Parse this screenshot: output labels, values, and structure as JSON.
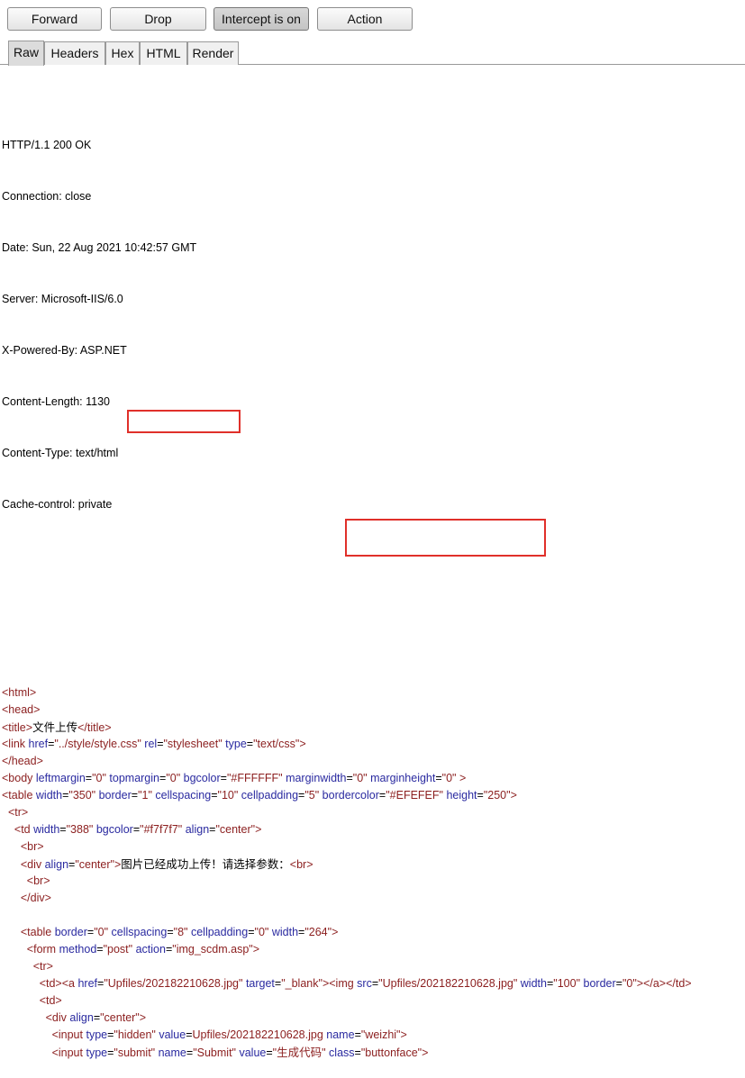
{
  "toolbar": {
    "forward": "Forward",
    "drop": "Drop",
    "intercept": "Intercept is on",
    "action": "Action"
  },
  "tabs": [
    "Raw",
    "Headers",
    "Hex",
    "HTML",
    "Render"
  ],
  "headers": [
    "HTTP/1.1 200 OK",
    "Connection: close",
    "Date: Sun, 22 Aug 2021 10:42:57 GMT",
    "Server: Microsoft-IIS/6.0",
    "X-Powered-By: ASP.NET",
    "Content-Length: 1130",
    "Content-Type: text/html",
    "Cache-control: private"
  ],
  "body_lines": [
    {
      "indent": "",
      "tokens": [
        [
          "t",
          "<html>"
        ]
      ]
    },
    {
      "indent": "",
      "tokens": [
        [
          "t",
          "<head>"
        ]
      ]
    },
    {
      "indent": "",
      "tokens": [
        [
          "t",
          "<title>"
        ],
        [
          "cn",
          "文件上传"
        ],
        [
          "t",
          "</title>"
        ]
      ]
    },
    {
      "indent": "",
      "tokens": [
        [
          "t",
          "<link "
        ],
        [
          "a",
          "href"
        ],
        [
          "p",
          "="
        ],
        [
          "v",
          "\"../style/style.css\""
        ],
        [
          "p",
          " "
        ],
        [
          "a",
          "rel"
        ],
        [
          "p",
          "="
        ],
        [
          "v",
          "\"stylesheet\""
        ],
        [
          "p",
          " "
        ],
        [
          "a",
          "type"
        ],
        [
          "p",
          "="
        ],
        [
          "v",
          "\"text/css\""
        ],
        [
          "t",
          ">"
        ]
      ]
    },
    {
      "indent": "",
      "tokens": [
        [
          "t",
          "</head>"
        ]
      ]
    },
    {
      "indent": "",
      "tokens": [
        [
          "t",
          "<body "
        ],
        [
          "a",
          "leftmargin"
        ],
        [
          "p",
          "="
        ],
        [
          "v",
          "\"0\""
        ],
        [
          "p",
          " "
        ],
        [
          "a",
          "topmargin"
        ],
        [
          "p",
          "="
        ],
        [
          "v",
          "\"0\""
        ],
        [
          "p",
          " "
        ],
        [
          "a",
          "bgcolor"
        ],
        [
          "p",
          "="
        ],
        [
          "v",
          "\"#FFFFFF\""
        ],
        [
          "p",
          " "
        ],
        [
          "a",
          "marginwidth"
        ],
        [
          "p",
          "="
        ],
        [
          "v",
          "\"0\""
        ],
        [
          "p",
          " "
        ],
        [
          "a",
          "marginheight"
        ],
        [
          "p",
          "="
        ],
        [
          "v",
          "\"0\""
        ],
        [
          "t",
          " >"
        ]
      ]
    },
    {
      "indent": "",
      "tokens": [
        [
          "t",
          "<table "
        ],
        [
          "a",
          "width"
        ],
        [
          "p",
          "="
        ],
        [
          "v",
          "\"350\""
        ],
        [
          "p",
          " "
        ],
        [
          "a",
          "border"
        ],
        [
          "p",
          "="
        ],
        [
          "v",
          "\"1\""
        ],
        [
          "p",
          " "
        ],
        [
          "a",
          "cellspacing"
        ],
        [
          "p",
          "="
        ],
        [
          "v",
          "\"10\""
        ],
        [
          "p",
          " "
        ],
        [
          "a",
          "cellpadding"
        ],
        [
          "p",
          "="
        ],
        [
          "v",
          "\"5\""
        ],
        [
          "p",
          " "
        ],
        [
          "a",
          "bordercolor"
        ],
        [
          "p",
          "="
        ],
        [
          "v",
          "\"#EFEFEF\""
        ],
        [
          "p",
          " "
        ],
        [
          "a",
          "height"
        ],
        [
          "p",
          "="
        ],
        [
          "v",
          "\"250\""
        ],
        [
          "t",
          ">"
        ]
      ]
    },
    {
      "indent": "  ",
      "tokens": [
        [
          "t",
          "<tr>"
        ]
      ]
    },
    {
      "indent": "    ",
      "tokens": [
        [
          "t",
          "<td "
        ],
        [
          "a",
          "width"
        ],
        [
          "p",
          "="
        ],
        [
          "v",
          "\"388\""
        ],
        [
          "p",
          " "
        ],
        [
          "a",
          "bgcolor"
        ],
        [
          "p",
          "="
        ],
        [
          "v",
          "\"#f7f7f7\""
        ],
        [
          "p",
          " "
        ],
        [
          "a",
          "align"
        ],
        [
          "p",
          "="
        ],
        [
          "v",
          "\"center\""
        ],
        [
          "t",
          ">"
        ]
      ]
    },
    {
      "indent": "      ",
      "tokens": [
        [
          "t",
          "<br>"
        ]
      ]
    },
    {
      "indent": "      ",
      "tokens": [
        [
          "t",
          "<div "
        ],
        [
          "a",
          "align"
        ],
        [
          "p",
          "="
        ],
        [
          "v",
          "\"center\""
        ],
        [
          "t",
          ">"
        ],
        [
          "cn",
          "图片已经成功上传！请选择参数："
        ],
        [
          "t",
          "<br>"
        ]
      ]
    },
    {
      "indent": "        ",
      "tokens": [
        [
          "t",
          "<br>"
        ]
      ]
    },
    {
      "indent": "      ",
      "tokens": [
        [
          "t",
          "</div>"
        ]
      ]
    },
    {
      "indent": "",
      "tokens": []
    },
    {
      "indent": "      ",
      "tokens": [
        [
          "t",
          "<table "
        ],
        [
          "a",
          "border"
        ],
        [
          "p",
          "="
        ],
        [
          "v",
          "\"0\""
        ],
        [
          "p",
          " "
        ],
        [
          "a",
          "cellspacing"
        ],
        [
          "p",
          "="
        ],
        [
          "v",
          "\"8\""
        ],
        [
          "p",
          " "
        ],
        [
          "a",
          "cellpadding"
        ],
        [
          "p",
          "="
        ],
        [
          "v",
          "\"0\""
        ],
        [
          "p",
          " "
        ],
        [
          "a",
          "width"
        ],
        [
          "p",
          "="
        ],
        [
          "v",
          "\"264\""
        ],
        [
          "t",
          ">"
        ]
      ]
    },
    {
      "indent": "        ",
      "tokens": [
        [
          "t",
          "<form "
        ],
        [
          "a",
          "method"
        ],
        [
          "p",
          "="
        ],
        [
          "v",
          "\"post\""
        ],
        [
          "p",
          " "
        ],
        [
          "a",
          "action"
        ],
        [
          "p",
          "="
        ],
        [
          "v",
          "\"img_scdm.asp\""
        ],
        [
          "t",
          ">"
        ]
      ]
    },
    {
      "indent": "          ",
      "tokens": [
        [
          "t",
          "<tr>"
        ]
      ]
    },
    {
      "indent": "            ",
      "tokens": [
        [
          "t",
          "<td>"
        ],
        [
          "t",
          "<a "
        ],
        [
          "a",
          "href"
        ],
        [
          "p",
          "="
        ],
        [
          "v",
          "\"Upfiles/202182210628.jpg\""
        ],
        [
          "p",
          " "
        ],
        [
          "a",
          "target"
        ],
        [
          "p",
          "="
        ],
        [
          "v",
          "\"_blank\""
        ],
        [
          "t",
          ">"
        ],
        [
          "t",
          "<img "
        ],
        [
          "a",
          "src"
        ],
        [
          "p",
          "="
        ],
        [
          "v",
          "\"Upfiles/202182210628.jpg\""
        ],
        [
          "p",
          " "
        ],
        [
          "a",
          "width"
        ],
        [
          "p",
          "="
        ],
        [
          "v",
          "\"100\""
        ],
        [
          "p",
          " "
        ],
        [
          "a",
          "border"
        ],
        [
          "p",
          "="
        ],
        [
          "v",
          "\"0\""
        ],
        [
          "t",
          "></a></td>"
        ]
      ]
    },
    {
      "indent": "            ",
      "tokens": [
        [
          "t",
          "<td>"
        ]
      ]
    },
    {
      "indent": "              ",
      "tokens": [
        [
          "t",
          "<div "
        ],
        [
          "a",
          "align"
        ],
        [
          "p",
          "="
        ],
        [
          "v",
          "\"center\""
        ],
        [
          "t",
          ">"
        ]
      ]
    },
    {
      "indent": "                ",
      "tokens": [
        [
          "t",
          "<input "
        ],
        [
          "a",
          "type"
        ],
        [
          "p",
          "="
        ],
        [
          "v",
          "\"hidden\""
        ],
        [
          "p",
          " "
        ],
        [
          "a",
          "value"
        ],
        [
          "p",
          "="
        ],
        [
          "v",
          "Upfiles/202182210628.jpg"
        ],
        [
          "p",
          " "
        ],
        [
          "a",
          "name"
        ],
        [
          "p",
          "="
        ],
        [
          "v",
          "\"weizhi\""
        ],
        [
          "t",
          ">"
        ]
      ]
    },
    {
      "indent": "                ",
      "tokens": [
        [
          "t",
          "<input "
        ],
        [
          "a",
          "type"
        ],
        [
          "p",
          "="
        ],
        [
          "v",
          "\"submit\""
        ],
        [
          "p",
          " "
        ],
        [
          "a",
          "name"
        ],
        [
          "p",
          "="
        ],
        [
          "v",
          "\"Submit\""
        ],
        [
          "p",
          " "
        ],
        [
          "a",
          "value"
        ],
        [
          "p",
          "="
        ],
        [
          "v",
          "\""
        ],
        [
          "cnv",
          "生成代码"
        ],
        [
          "v",
          "\""
        ],
        [
          "p",
          " "
        ],
        [
          "a",
          "class"
        ],
        [
          "p",
          "="
        ],
        [
          "v",
          "\"buttonface\""
        ],
        [
          "t",
          ">"
        ]
      ]
    }
  ]
}
